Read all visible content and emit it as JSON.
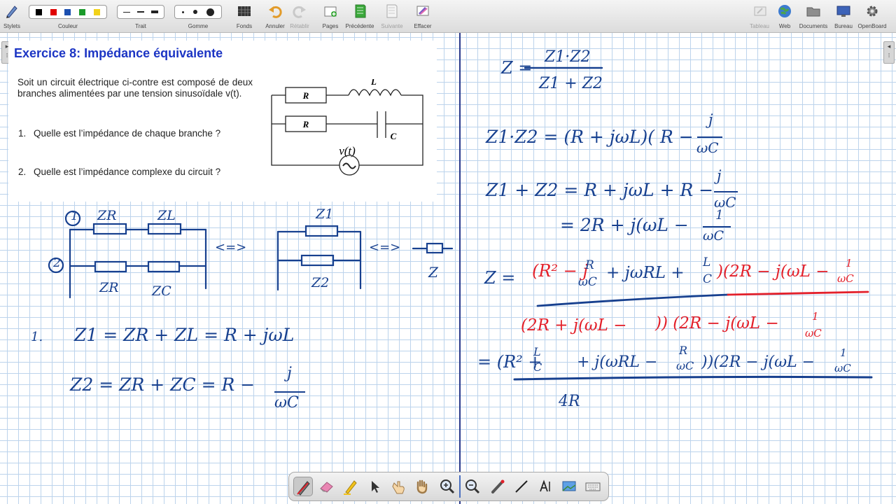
{
  "toolbar": {
    "stylets": "Stylets",
    "couleur": "Couleur",
    "trait": "Trait",
    "gomme": "Gomme",
    "fonds": "Fonds",
    "annuler": "Annuler",
    "retablir": "Rétablir",
    "pages": "Pages",
    "precedente": "Précédente",
    "suivante": "Suivante",
    "effacer": "Effacer",
    "tableau": "Tableau",
    "web": "Web",
    "documents": "Documents",
    "bureau": "Bureau",
    "openboard": "OpenBoard",
    "colors": [
      "#000000",
      "#e00000",
      "#1b4fb0",
      "#1a9a2a",
      "#f2d21a"
    ]
  },
  "exercise": {
    "title": "Exercice 8: Impédance équivalente",
    "intro": "Soit un circuit électrique ci-contre est composé de deux branches alimentées par une tension sinusoïdale v(t).",
    "q1_num": "1.",
    "q1": "Quelle est l’impédance de chaque branche ?",
    "q2_num": "2.",
    "q2": "Quelle est l’impédance complexe du circuit ?",
    "circuit": {
      "r1": "R",
      "l": "L",
      "r2": "R",
      "c": "C",
      "source": "v(t)",
      "tilde": "~"
    }
  },
  "handwriting_left": {
    "branch1": "1",
    "branch2": "2",
    "zr_top": "ZR",
    "zl_top": "ZL",
    "zr_bottom": "ZR",
    "zc_bottom": "ZC",
    "equiv_arrow1": "<=>",
    "z1_label": "Z1",
    "z2_label": "Z2",
    "equiv_arrow2": "<=>",
    "z_label": "Z",
    "q1_mark": "1.",
    "eq1": "Z1 = ZR + ZL = R + jωL",
    "eq2_lhs": "Z2 = ZR + ZC = R −",
    "eq2_num": "j",
    "eq2_den": "ωC"
  },
  "handwriting_right": {
    "z_def_lhs": "Z =",
    "z_def_num": "Z1·Z2",
    "z_def_den": "Z1 + Z2",
    "prod_lhs": "Z1·Z2 = (R + jωL)( R −",
    "prod_num": "j",
    "prod_den": "ωC",
    "sum_lhs": "Z1 + Z2 = R + jωL + R −",
    "sum_num": "j",
    "sum_den": "ωC",
    "sum2": "= 2R + j(ωL −",
    "sum2_num": "1",
    "sum2_den": "ωC",
    "z_big_lhs": "Z =",
    "z_big_num_blue": "(R² − j",
    "z_big_num_frac_n": "R",
    "z_big_num_frac_d": "ωC",
    "z_big_num_mid": "+ jωRL +",
    "z_big_num_frac2_n": "L",
    "z_big_num_frac2_d": "C",
    "z_big_num_red": ")(2R − j(ωL −",
    "z_big_num_red_n": "1",
    "z_big_num_red_d": "ωC",
    "z_big_den_red1": "(2R + j(ωL −",
    "z_big_den_red2": ")) (2R − j(ωL −",
    "z_big_den_n": "1",
    "z_big_den_d": "ωC",
    "final_lhs": "= (R² +",
    "final_f1_n": "L",
    "final_f1_d": "C",
    "final_mid": "+ j(ωRL −",
    "final_f2_n": "R",
    "final_f2_d": "ωC",
    "final_tail": "))(2R − j(ωL −",
    "final_f3_n": "1",
    "final_f3_d": "ωC",
    "final_den": "4R"
  }
}
